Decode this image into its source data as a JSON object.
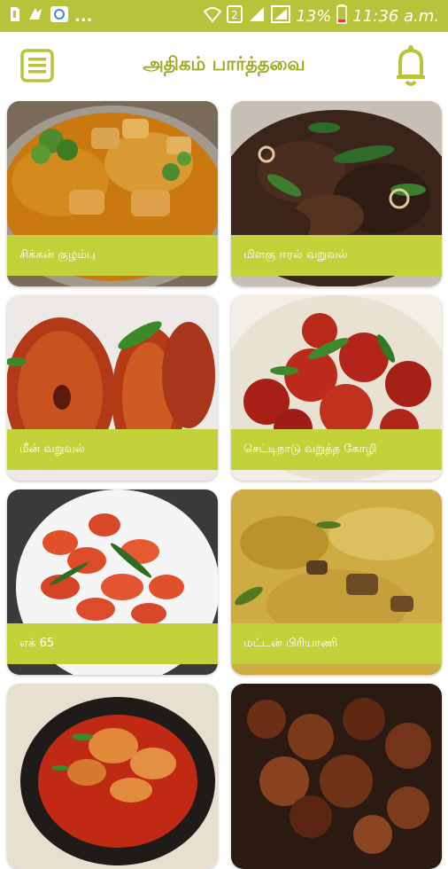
{
  "status_bar": {
    "left_icons": [
      "sim-icon",
      "notification-icon",
      "sync-icon"
    ],
    "more": "...",
    "right_icons": [
      "wifi-icon",
      "data-icon",
      "signal-icon",
      "signal-alt-icon",
      "battery-icon"
    ],
    "battery": "13%",
    "time": "11:36 a.m."
  },
  "app_bar": {
    "title": "அதிகம் பார்த்தவை",
    "menu_icon": "menu-icon",
    "bell_icon": "bell-icon"
  },
  "colors": {
    "accent": "#b6c33b",
    "title": "#9bab20",
    "label_bar": "#c3d13a"
  },
  "recipes": [
    {
      "name": "சிக்கன் குழம்பு"
    },
    {
      "name": "மிளகு ஈரல் வறுவல்"
    },
    {
      "name": "மீன் வறுவல்"
    },
    {
      "name": "செட்டிநாடு வறுத்த கோழி"
    },
    {
      "name": "எக் 65"
    },
    {
      "name": "மட்டன் பிரியாணி"
    },
    {
      "name": ""
    },
    {
      "name": ""
    }
  ]
}
